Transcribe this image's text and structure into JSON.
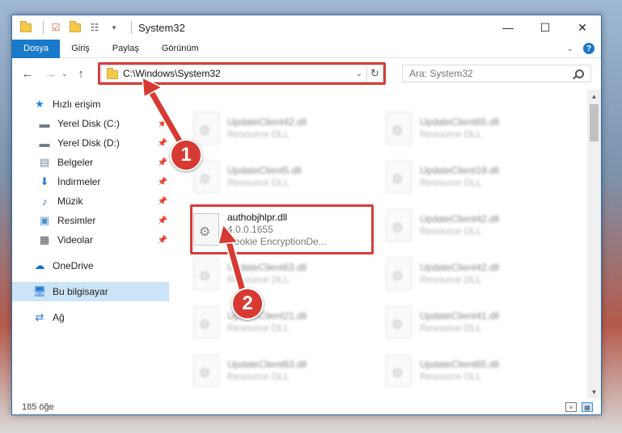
{
  "window": {
    "title": "System32",
    "controls": {
      "minimize": "—",
      "maximize": "☐",
      "close": "✕"
    }
  },
  "ribbon": {
    "tabs": [
      "Dosya",
      "Giriş",
      "Paylaş",
      "Görünüm"
    ],
    "active_tab": "Dosya"
  },
  "address": {
    "path": "C:\\Windows\\System32",
    "search_placeholder": "Ara: System32"
  },
  "nav": {
    "quick_access": "Hızlı erişim",
    "items": [
      {
        "label": "Yerel Disk (C:)",
        "icon": "drive-icon"
      },
      {
        "label": "Yerel Disk (D:)",
        "icon": "drive-icon"
      },
      {
        "label": "Belgeler",
        "icon": "documents-icon"
      },
      {
        "label": "İndirmeler",
        "icon": "downloads-icon"
      },
      {
        "label": "Müzik",
        "icon": "music-icon"
      },
      {
        "label": "Resimler",
        "icon": "pictures-icon"
      },
      {
        "label": "Videolar",
        "icon": "videos-icon"
      }
    ],
    "onedrive": "OneDrive",
    "this_pc": "Bu bilgisayar",
    "network": "Ağ"
  },
  "files": {
    "left_column": [
      {
        "name": "UpdateClient42.dll",
        "sub": "Resource DLL"
      },
      {
        "name": "UpdateClient5.dll",
        "sub": "Resource DLL"
      },
      {
        "name": "authobjhlpr.dll",
        "version": "4.0.0.1655",
        "sub": "Cookie EncryptionDe..."
      },
      {
        "name": "UpdateClient63.dll",
        "sub": "Resource DLL"
      },
      {
        "name": "UpdateClient21.dll",
        "sub": "Resource DLL"
      },
      {
        "name": "UpdateClient63.dll",
        "sub": "Resource DLL"
      }
    ],
    "right_column": [
      {
        "name": "UpdateClient65.dll",
        "sub": "Resource DLL"
      },
      {
        "name": "UpdateClient19.dll",
        "sub": "Resource DLL"
      },
      {
        "name": "UpdateClient42.dll",
        "sub": "Resource DLL"
      },
      {
        "name": "UpdateClient42.dll",
        "sub": "Resource DLL"
      },
      {
        "name": "UpdateClient41.dll",
        "sub": "Resource DLL"
      },
      {
        "name": "UpdateClient65.dll",
        "sub": "Resource DLL"
      }
    ]
  },
  "status": {
    "item_count": "185 öğe"
  },
  "annotations": {
    "step1": "1",
    "step2": "2",
    "color": "#d63a32"
  }
}
